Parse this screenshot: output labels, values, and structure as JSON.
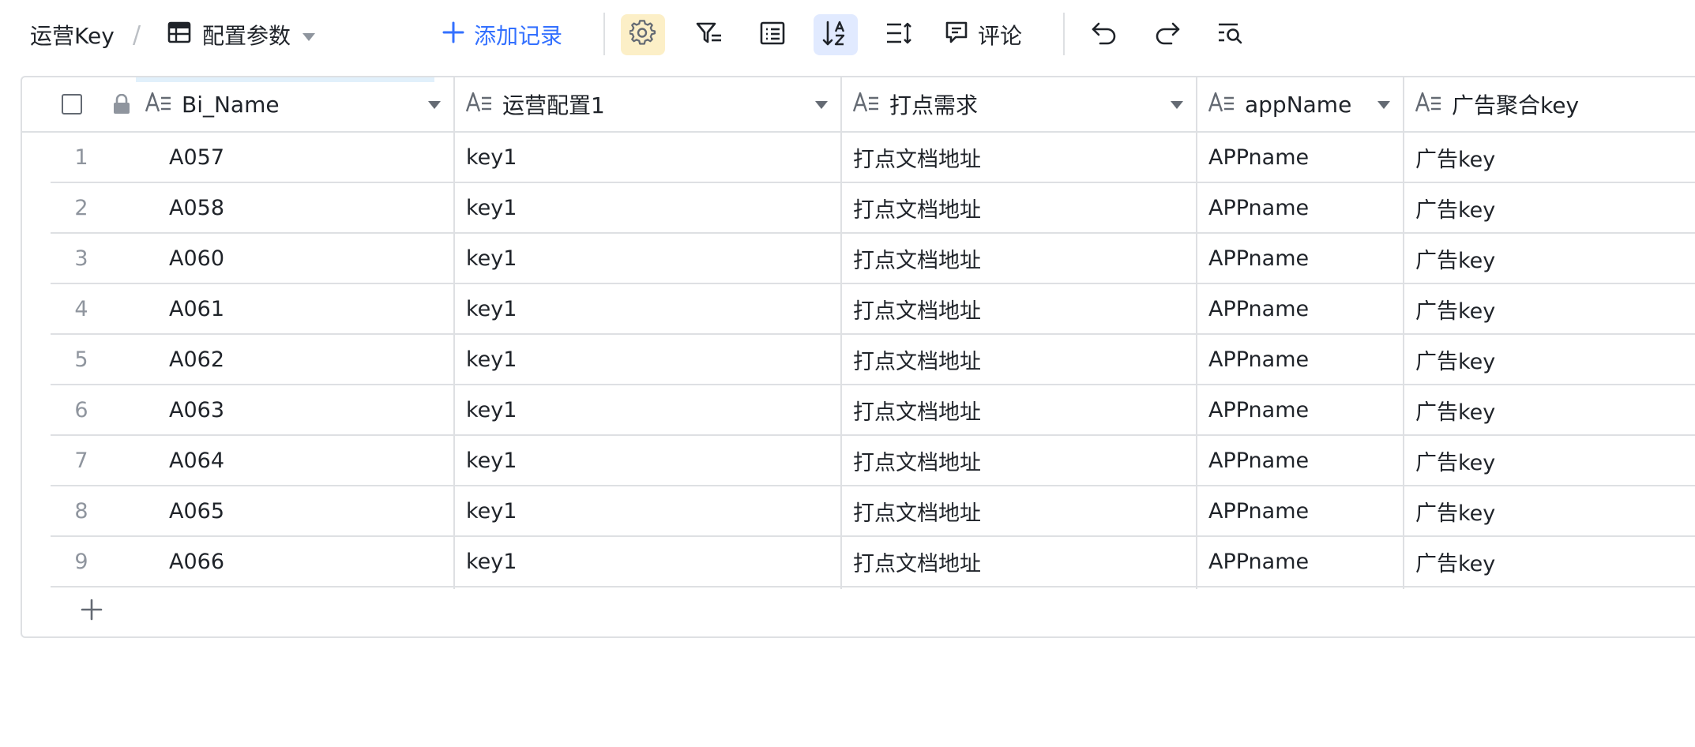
{
  "breadcrumb": {
    "root": "运营Key",
    "separator": "/",
    "view_name": "配置参数"
  },
  "toolbar": {
    "add_record_label": "添加记录",
    "comment_label": "评论"
  },
  "table": {
    "columns": [
      {
        "key": "bi_name",
        "label": "Bi_Name"
      },
      {
        "key": "op_config",
        "label": "运营配置1"
      },
      {
        "key": "tracking",
        "label": "打点需求"
      },
      {
        "key": "app_name",
        "label": "appName"
      },
      {
        "key": "ad_key",
        "label": "广告聚合key"
      }
    ],
    "rows": [
      {
        "num": "1",
        "bi_name": "A057",
        "op_config": "key1",
        "tracking": "打点文档地址",
        "app_name": "APPname",
        "ad_key": "广告key"
      },
      {
        "num": "2",
        "bi_name": "A058",
        "op_config": "key1",
        "tracking": "打点文档地址",
        "app_name": "APPname",
        "ad_key": "广告key"
      },
      {
        "num": "3",
        "bi_name": "A060",
        "op_config": "key1",
        "tracking": "打点文档地址",
        "app_name": "APPname",
        "ad_key": "广告key"
      },
      {
        "num": "4",
        "bi_name": "A061",
        "op_config": "key1",
        "tracking": "打点文档地址",
        "app_name": "APPname",
        "ad_key": "广告key"
      },
      {
        "num": "5",
        "bi_name": "A062",
        "op_config": "key1",
        "tracking": "打点文档地址",
        "app_name": "APPname",
        "ad_key": "广告key"
      },
      {
        "num": "6",
        "bi_name": "A063",
        "op_config": "key1",
        "tracking": "打点文档地址",
        "app_name": "APPname",
        "ad_key": "广告key"
      },
      {
        "num": "7",
        "bi_name": "A064",
        "op_config": "key1",
        "tracking": "打点文档地址",
        "app_name": "APPname",
        "ad_key": "广告key"
      },
      {
        "num": "8",
        "bi_name": "A065",
        "op_config": "key1",
        "tracking": "打点文档地址",
        "app_name": "APPname",
        "ad_key": "广告key"
      },
      {
        "num": "9",
        "bi_name": "A066",
        "op_config": "key1",
        "tracking": "打点文档地址",
        "app_name": "APPname",
        "ad_key": "广告key"
      }
    ]
  },
  "icons": {
    "table": "table-icon",
    "add": "plus-icon",
    "settings": "gear-icon",
    "filter": "filter-icon",
    "group": "list-icon",
    "sort": "sort-icon",
    "row_height": "row-height-icon",
    "comment": "comment-icon",
    "undo": "undo-icon",
    "redo": "redo-icon",
    "search": "search-icon",
    "text_field": "text-field-icon",
    "lock": "lock-icon"
  },
  "colors": {
    "accent": "#3370ff",
    "gear_active_bg": "#fcefc7",
    "sort_active_bg": "#e1eaff",
    "border": "#dee0e3"
  }
}
